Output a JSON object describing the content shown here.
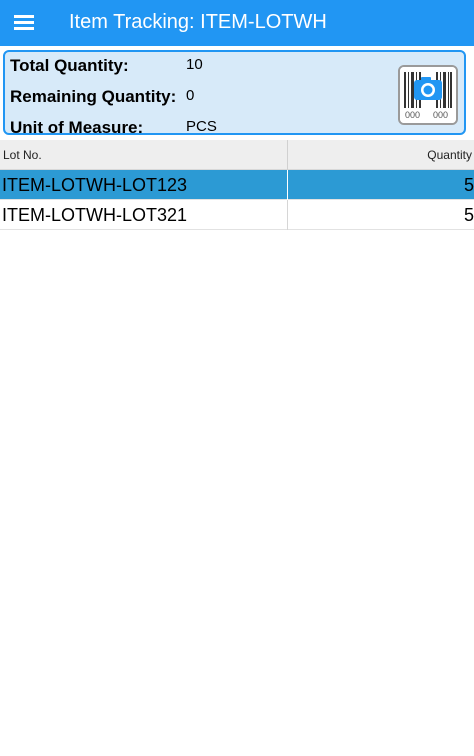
{
  "app_bar": {
    "title": "Item Tracking: ITEM-LOTWH",
    "bg_color": "#2196f3",
    "menu_icon": "hamburger-menu-icon"
  },
  "info": {
    "total_quantity_label": "Total Quantity:",
    "total_quantity_value": "10",
    "remaining_quantity_label": "Remaining Quantity:",
    "remaining_quantity_value": "0",
    "unit_of_measure_label": "Unit of Measure:",
    "unit_of_measure_value": "PCS",
    "panel_bg_color": "#d7eaf9",
    "scan_icon": "barcode-camera-icon",
    "scan_icon_digits_left": "000",
    "scan_icon_digits_right": "000"
  },
  "grid": {
    "columns": [
      "Lot No.",
      "Quantity"
    ],
    "rows": [
      {
        "lot": "ITEM-LOTWH-LOT123",
        "quantity": "5",
        "selected": true
      },
      {
        "lot": "ITEM-LOTWH-LOT321",
        "quantity": "5",
        "selected": false
      }
    ],
    "selected_color": "#2c9ad4"
  }
}
